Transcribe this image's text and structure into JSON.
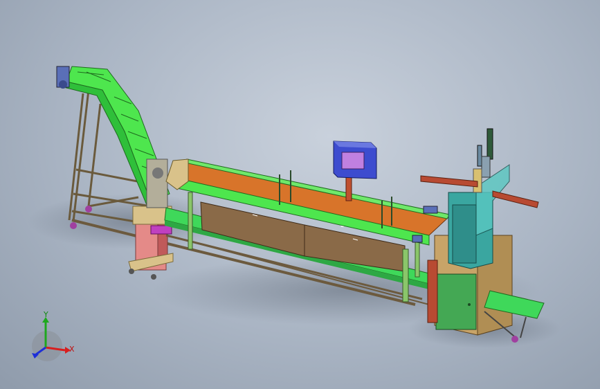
{
  "triad": {
    "x_label": "X",
    "y_label": "Y",
    "x_color": "#d81e1e",
    "y_color": "#1ea81e",
    "z_color": "#1e2fd8"
  },
  "colors": {
    "frame_green": "#4ee64e",
    "trough_orange": "#d8742a",
    "panel_brown": "#8a6a48",
    "control_box": "#3d4ccf",
    "cabinet_teal": "#3aa6a0",
    "base_tan": "#c8a468",
    "conveyor_green": "#3fd85a",
    "bracket_red": "#b84a32",
    "pink_stand": "#e48a88"
  }
}
